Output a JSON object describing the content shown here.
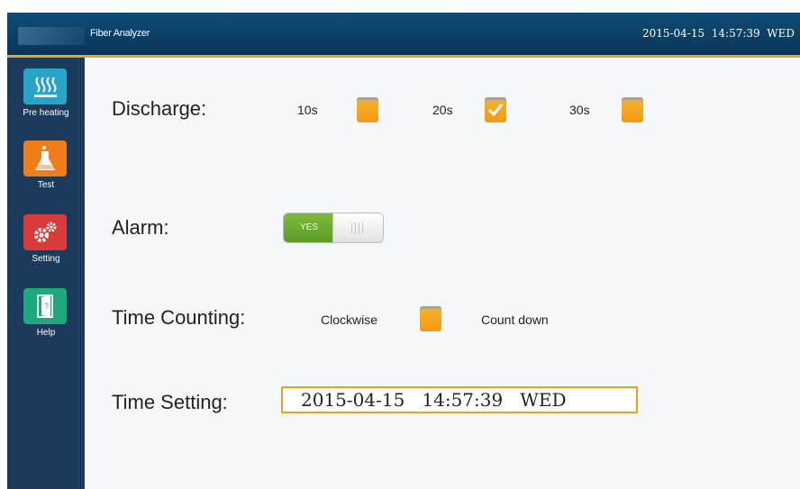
{
  "app": {
    "title": "Fiber Analyzer",
    "clock": "2015-04-15  14:57:39  WED"
  },
  "sidebar": {
    "items": [
      {
        "label": "Pre heating",
        "icon": "heater-icon",
        "color": "#29a3c7"
      },
      {
        "label": "Test",
        "icon": "flask-icon",
        "color": "#ee7d1a"
      },
      {
        "label": "Setting",
        "icon": "gear-icon",
        "color": "#d93b3b"
      },
      {
        "label": "Help",
        "icon": "door-exit-icon",
        "color": "#1fa87e"
      }
    ]
  },
  "settings": {
    "discharge": {
      "label": "Discharge:",
      "options": [
        {
          "label": "10s",
          "checked": false
        },
        {
          "label": "20s",
          "checked": true
        },
        {
          "label": "30s",
          "checked": false
        }
      ]
    },
    "alarm": {
      "label": "Alarm:",
      "toggle_on_text": "YES",
      "value": true
    },
    "time_counting": {
      "label": "Time Counting:",
      "option_clockwise": "Clockwise",
      "option_countdown": "Count down"
    },
    "time_setting": {
      "label": "Time Setting:",
      "value": "2015-04-15   14:57:39   WED"
    }
  },
  "colors": {
    "accent": "#f0a020",
    "titlebar": "#0b3e63",
    "sidebar": "#1c3a5c",
    "toggle_on": "#6aa82f"
  }
}
